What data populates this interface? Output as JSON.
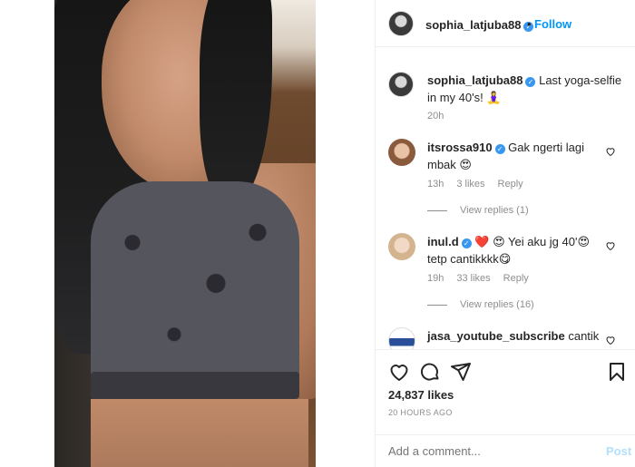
{
  "header": {
    "username": "sophia_latjuba88",
    "separator": "•",
    "follow_label": "Follow"
  },
  "caption": {
    "username": "sophia_latjuba88",
    "text": " Last yoga-selfie in my 40's! 🧘‍♀️",
    "time": "20h"
  },
  "comments": [
    {
      "username": "itsrossa910",
      "text": " Gak ngerti lagi mbak 😍",
      "time": "13h",
      "likes": "3 likes",
      "reply": "Reply",
      "view_replies": "View replies (1)"
    },
    {
      "username": "inul.d",
      "text": " ❤️ 😍 Yei aku jg 40'😍 tetp cantikkkk😋",
      "time": "19h",
      "likes": "33 likes",
      "reply": "Reply",
      "view_replies": "View replies (16)"
    },
    {
      "username": "jasa_youtube_subscribe",
      "text": " cantik"
    }
  ],
  "actions": {
    "likes": "24,837 likes",
    "timestamp": "20 HOURS AGO"
  },
  "add_comment": {
    "placeholder": "Add a comment...",
    "post_label": "Post"
  },
  "colors": {
    "link_blue": "#0095f6",
    "verified_blue": "#3897f0",
    "secondary_text": "#8e8e8e",
    "post_disabled": "#b2dffc"
  }
}
